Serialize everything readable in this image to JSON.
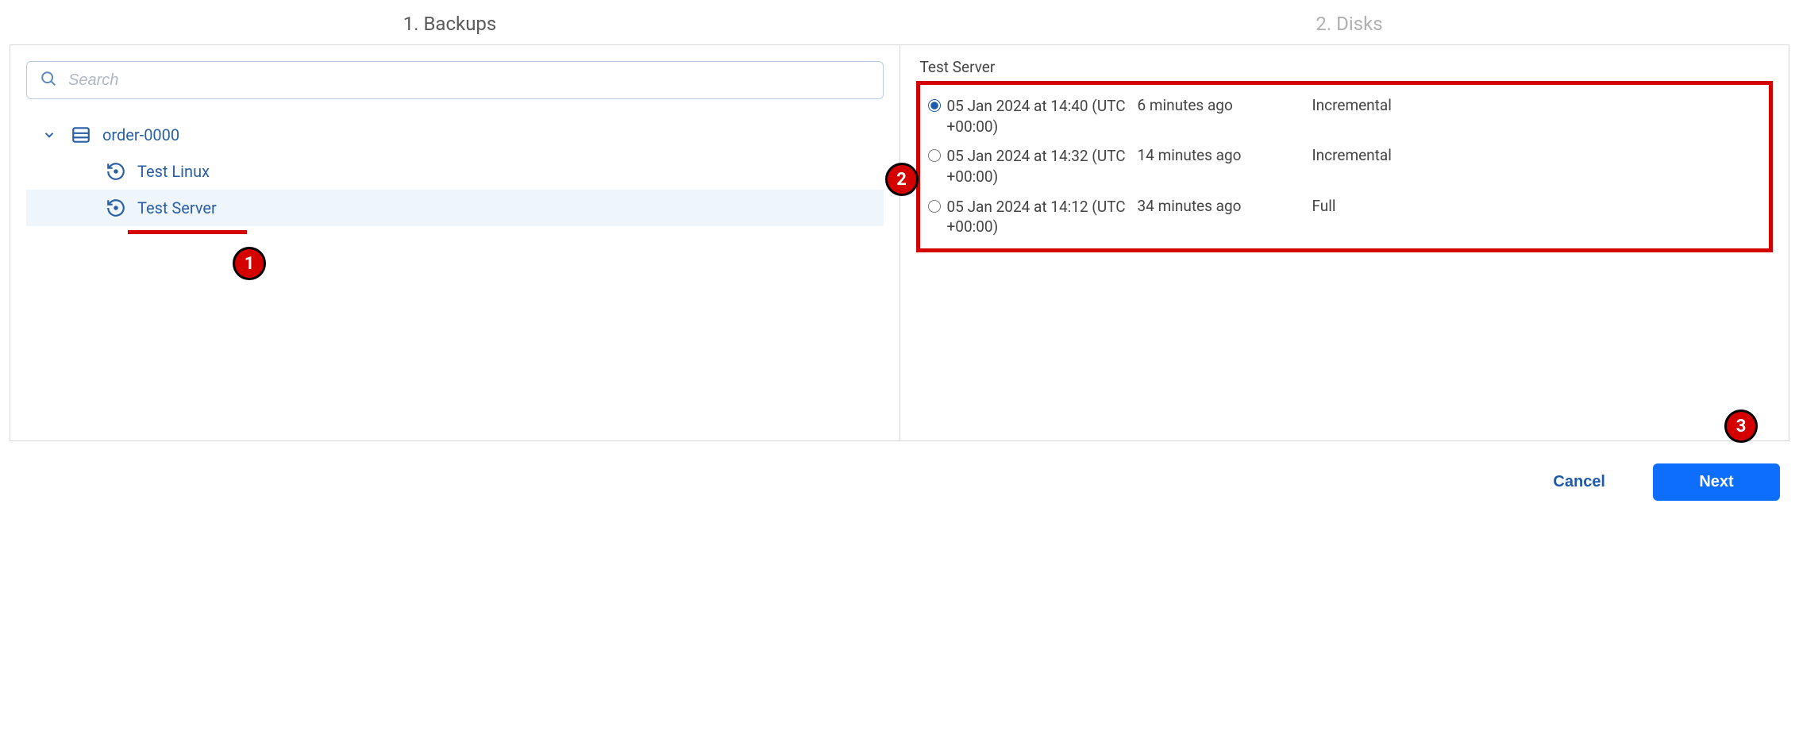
{
  "wizard": {
    "step1": "1. Backups",
    "step2": "2. Disks"
  },
  "search": {
    "placeholder": "Search",
    "value": ""
  },
  "tree": {
    "parent": {
      "label": "order-0000"
    },
    "children": [
      {
        "label": "Test Linux",
        "selected": false
      },
      {
        "label": "Test Server",
        "selected": true
      }
    ]
  },
  "rightPanel": {
    "title": "Test Server",
    "backups": [
      {
        "date": "05 Jan 2024 at 14:40 (UTC +00:00)",
        "ago": "6 minutes ago",
        "type": "Incremental",
        "selected": true
      },
      {
        "date": "05 Jan 2024 at 14:32 (UTC +00:00)",
        "ago": "14 minutes ago",
        "type": "Incremental",
        "selected": false
      },
      {
        "date": "05 Jan 2024 at 14:12 (UTC +00:00)",
        "ago": "34 minutes ago",
        "type": "Full",
        "selected": false
      }
    ]
  },
  "footer": {
    "cancel": "Cancel",
    "next": "Next"
  },
  "annotations": {
    "a1": "1",
    "a2": "2",
    "a3": "3"
  }
}
